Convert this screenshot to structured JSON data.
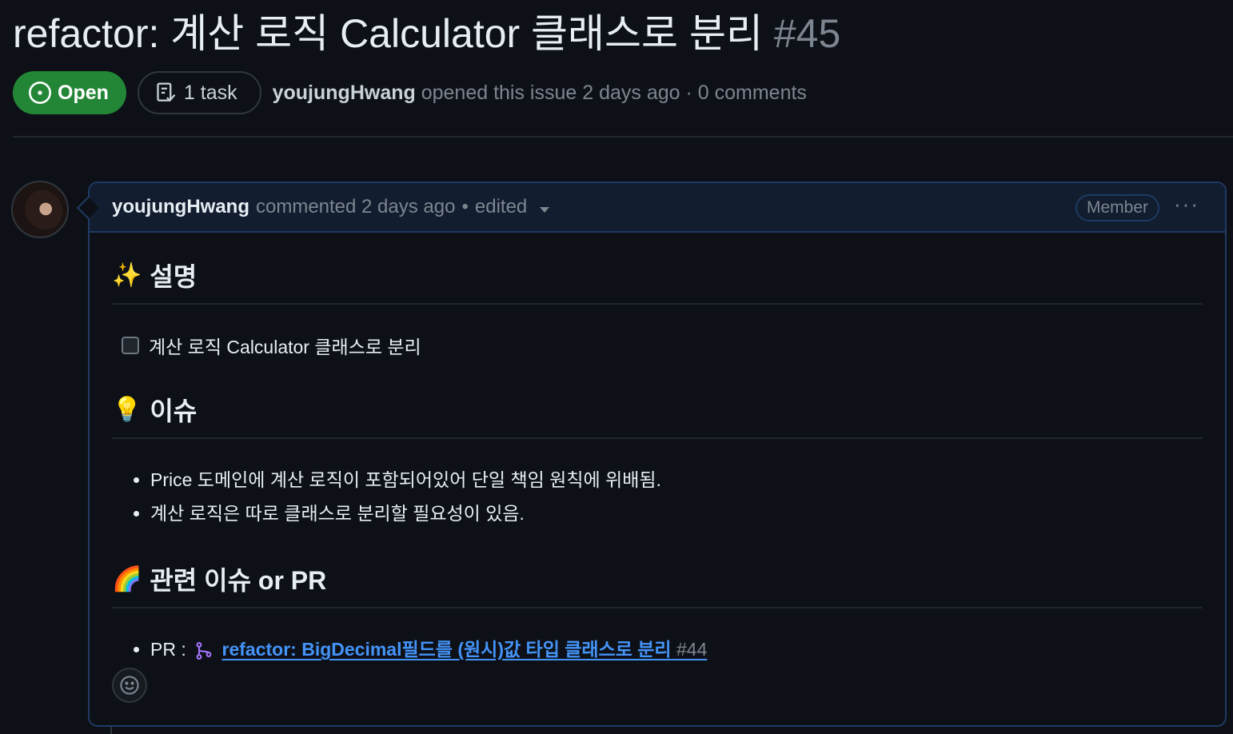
{
  "issue": {
    "title": "refactor: 계산 로직 Calculator 클래스로 분리",
    "number": "#45",
    "state": "Open",
    "tasks": "1 task",
    "author": "youjungHwang",
    "opened_text": "opened this issue 2 days ago · 0 comments"
  },
  "comment": {
    "author": "youjungHwang",
    "commented": "commented 2 days ago",
    "bullet": "•",
    "edited": "edited",
    "role": "Member",
    "menu": "···"
  },
  "body": {
    "sections": [
      {
        "emoji": "✨",
        "heading": "설명"
      },
      {
        "emoji": "💡",
        "heading": "이슈"
      },
      {
        "emoji": "🌈",
        "heading": "관련 이슈 or PR"
      }
    ],
    "task_label": "계산 로직 Calculator 클래스로 분리",
    "issues": [
      "Price 도메인에 계산 로직이 포함되어있어 단일 책임 원칙에 위배됨.",
      "계산 로직은 따로 클래스로 분리할 필요성이 있음."
    ],
    "pr_prefix": "PR :",
    "pr_title": "refactor: BigDecimal필드를 (원시)값 타입 클래스로 분리",
    "pr_number": "#44"
  },
  "icons": {
    "state": "issue-opened-icon",
    "tasks": "checklist-icon",
    "pr": "git-pull-request-icon",
    "reaction": "smiley-icon"
  },
  "colors": {
    "open_green": "#238636",
    "link_blue": "#4493f8",
    "pr_purple": "#a371f7"
  }
}
